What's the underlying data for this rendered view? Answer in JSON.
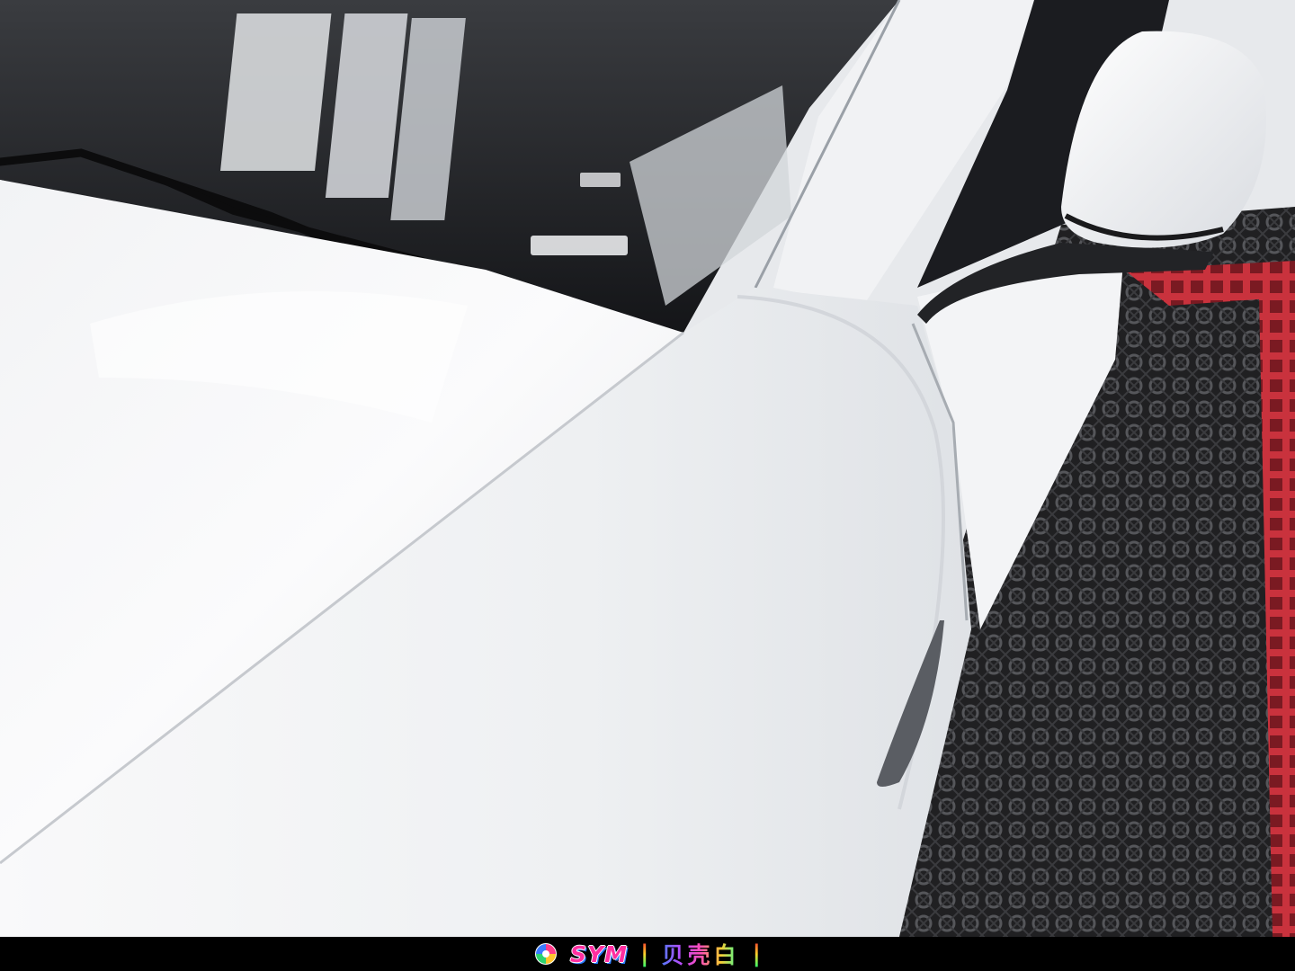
{
  "caption": {
    "brand": "SYM",
    "separator_left": "|",
    "product": "贝壳白",
    "separator_right": "|"
  },
  "palette": {
    "paint_white": "#f4f5f7",
    "glass_dark": "#1b1c1f",
    "floor_dark": "#2a2a2c",
    "floor_red": "#d83c46"
  }
}
